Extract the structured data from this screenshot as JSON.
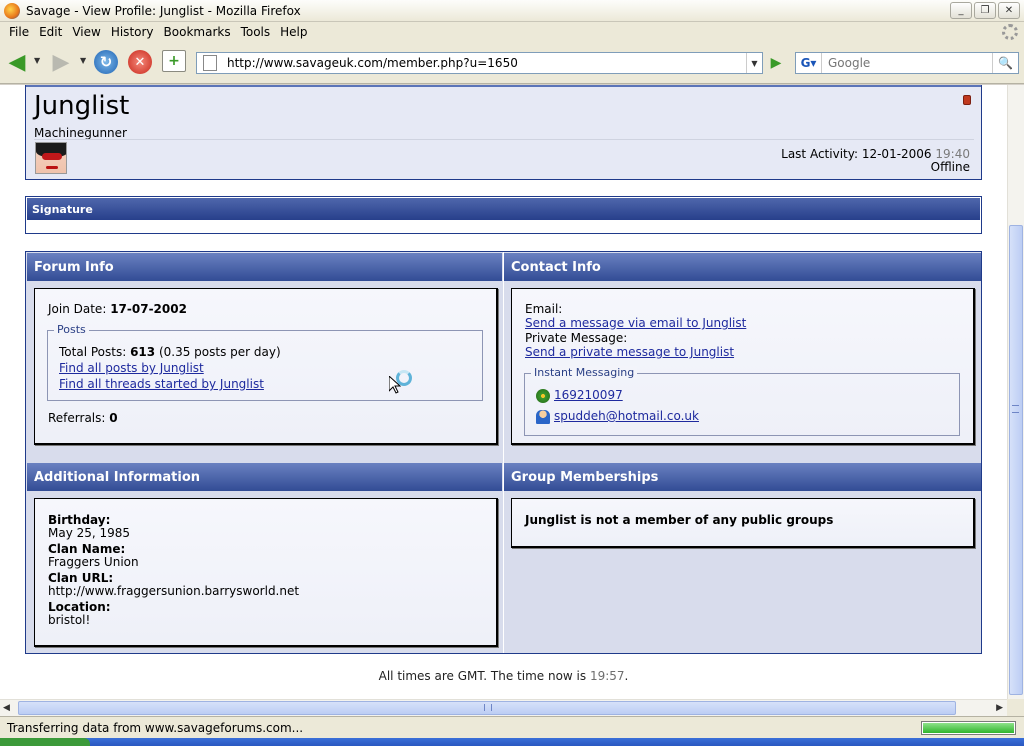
{
  "window": {
    "title": "Savage - View Profile: Junglist - Mozilla Firefox",
    "minimize": "_",
    "restore": "❐",
    "close": "✕"
  },
  "menu": {
    "items": [
      "File",
      "Edit",
      "View",
      "History",
      "Bookmarks",
      "Tools",
      "Help"
    ]
  },
  "toolbar": {
    "url": "http://www.savageuk.com/member.php?u=1650",
    "search_placeholder": "Google"
  },
  "profile": {
    "username": "Junglist",
    "user_title": "Machinegunner",
    "last_activity_label": "Last Activity:",
    "last_activity_date": "12-01-2006",
    "last_activity_time": "19:40",
    "online_status": "Offline"
  },
  "signature": {
    "heading": "Signature"
  },
  "forum_info": {
    "heading": "Forum Info",
    "join_date_label": "Join Date:",
    "join_date": "17-07-2002",
    "posts_legend": "Posts",
    "total_posts_label": "Total Posts:",
    "total_posts": "613",
    "posts_per_day": "(0.35 posts per day)",
    "find_posts_link": "Find all posts by Junglist",
    "find_threads_link": "Find all threads started by Junglist",
    "referrals_label": "Referrals:",
    "referrals": "0"
  },
  "contact_info": {
    "heading": "Contact Info",
    "email_label": "Email:",
    "email_link": "Send a message via email to Junglist",
    "pm_label": "Private Message:",
    "pm_link": "Send a private message to Junglist",
    "im_legend": "Instant Messaging",
    "icq": "169210097",
    "msn": "spuddeh@hotmail.co.uk"
  },
  "additional_info": {
    "heading": "Additional Information",
    "birthday_label": "Birthday:",
    "birthday": "May 25, 1985",
    "clan_name_label": "Clan Name:",
    "clan_name": "Fraggers Union",
    "clan_url_label": "Clan URL:",
    "clan_url": "http://www.fraggersunion.barrysworld.net",
    "location_label": "Location:",
    "location": "bristol!"
  },
  "groups": {
    "heading": "Group Memberships",
    "message": "Junglist is not a member of any public groups"
  },
  "footer": {
    "time_prefix": "All times are GMT. The time now is",
    "time": "19:57",
    "suffix": "."
  },
  "status_bar": {
    "text": "Transferring data from www.savageforums.com...",
    "progress": 1.0
  },
  "colors": {
    "panel_header": "#324c95",
    "panel_bg": "#d8dcec",
    "link": "#1e2a9e"
  }
}
